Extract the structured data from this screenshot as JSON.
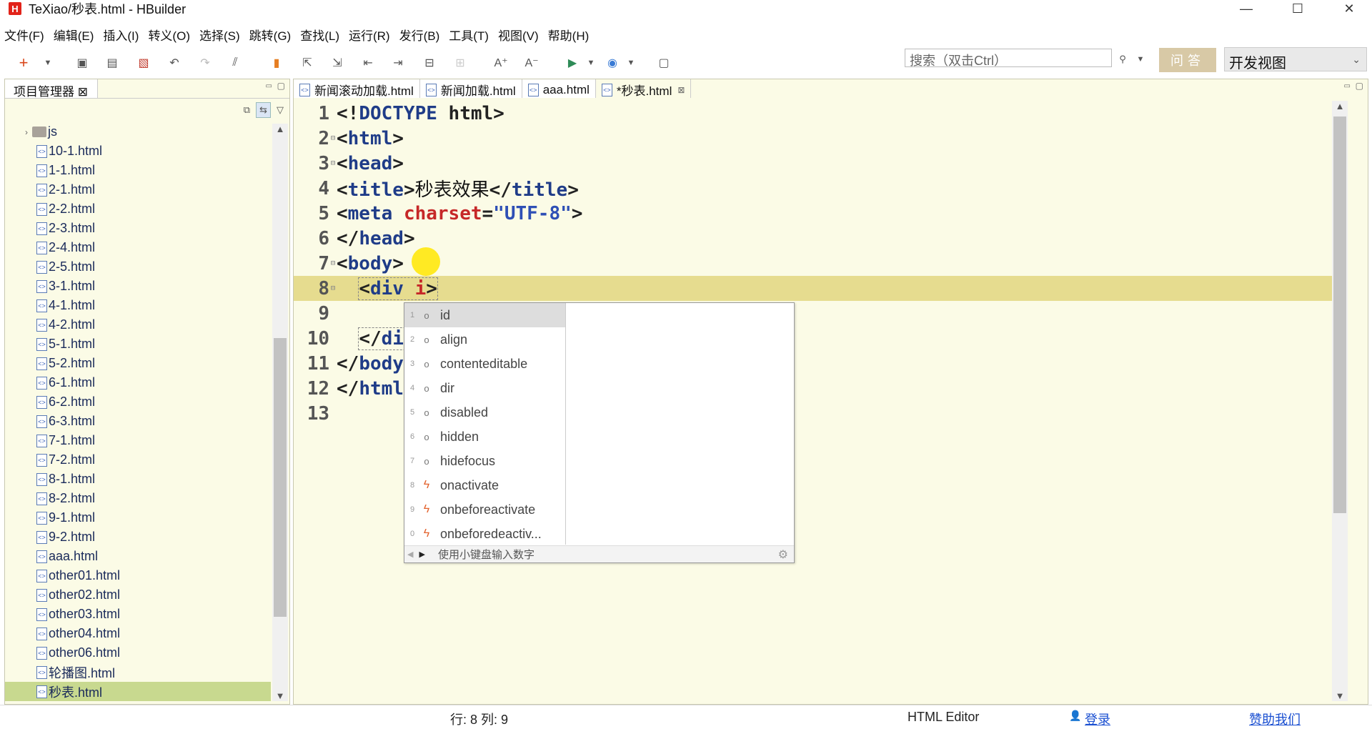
{
  "window": {
    "title": "TeXiao/秒表.html  -  HBuilder",
    "logo_letter": "H",
    "minimize": "—",
    "maximize": "☐",
    "close": "✕"
  },
  "menu": [
    "文件(F)",
    "编辑(E)",
    "插入(I)",
    "转义(O)",
    "选择(S)",
    "跳转(G)",
    "查找(L)",
    "运行(R)",
    "发行(B)",
    "工具(T)",
    "视图(V)",
    "帮助(H)"
  ],
  "toolbar": {
    "search_placeholder": "搜索（双击Ctrl）",
    "qa_label": "问答",
    "view_label": "开发视图"
  },
  "project": {
    "tab_label": "项目管理器 ⊠",
    "folder": "js",
    "files": [
      "10-1.html",
      "1-1.html",
      "2-1.html",
      "2-2.html",
      "2-3.html",
      "2-4.html",
      "2-5.html",
      "3-1.html",
      "4-1.html",
      "4-2.html",
      "5-1.html",
      "5-2.html",
      "6-1.html",
      "6-2.html",
      "6-3.html",
      "7-1.html",
      "7-2.html",
      "8-1.html",
      "8-2.html",
      "9-1.html",
      "9-2.html",
      "aaa.html",
      "other01.html",
      "other02.html",
      "other03.html",
      "other04.html",
      "other06.html",
      "轮播图.html",
      "秒表.html"
    ],
    "selected": "秒表.html"
  },
  "tabs": [
    {
      "label": "新闻滚动加载.html",
      "active": false
    },
    {
      "label": "新闻加载.html",
      "active": false
    },
    {
      "label": "aaa.html",
      "active": false
    },
    {
      "label": "*秒表.html",
      "active": true
    }
  ],
  "code": {
    "current_line": 8,
    "line_numbers": [
      "1",
      "2",
      "3",
      "4",
      "5",
      "6",
      "7",
      "8",
      "9",
      "10",
      "11",
      "12",
      "13"
    ]
  },
  "autocomplete": {
    "items": [
      {
        "num": "1",
        "icon": "circle",
        "label": "id"
      },
      {
        "num": "2",
        "icon": "circle",
        "label": "align"
      },
      {
        "num": "3",
        "icon": "circle",
        "label": "contenteditable"
      },
      {
        "num": "4",
        "icon": "circle",
        "label": "dir"
      },
      {
        "num": "5",
        "icon": "circle",
        "label": "disabled"
      },
      {
        "num": "6",
        "icon": "circle",
        "label": "hidden"
      },
      {
        "num": "7",
        "icon": "circle",
        "label": "hidefocus"
      },
      {
        "num": "8",
        "icon": "bolt",
        "label": "onactivate"
      },
      {
        "num": "9",
        "icon": "bolt",
        "label": "onbeforeactivate"
      },
      {
        "num": "0",
        "icon": "bolt",
        "label": "onbeforedeactiv..."
      }
    ],
    "hint": "使用小键盘输入数字"
  },
  "status": {
    "position": "行: 8 列: 9",
    "editor_type": "HTML Editor",
    "login": "登录",
    "sponsor": "赞助我们"
  }
}
